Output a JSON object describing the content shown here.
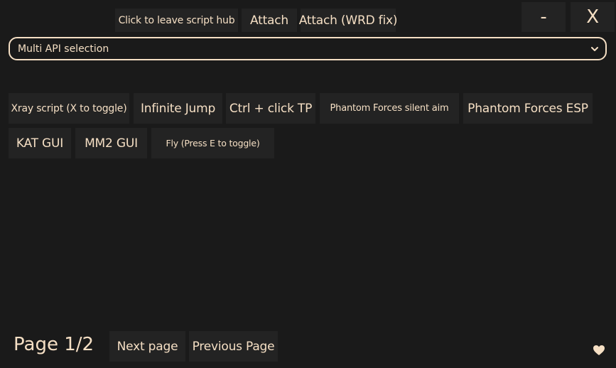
{
  "top_bar": {
    "leave_hub_label": "Click to leave script hub",
    "attach_label": "Attach",
    "attach_wrd_label": "Attach (WRD fix)",
    "minimize_label": "-",
    "close_label": "X"
  },
  "api_select": {
    "selected_value": "Multi API selection"
  },
  "scripts": {
    "row1": [
      "Xray script (X to toggle)",
      "Infinite Jump",
      "Ctrl + click TP",
      "Phantom Forces silent aim",
      "Phantom Forces ESP"
    ],
    "row2": [
      "KAT GUI",
      "MM2 GUI",
      "Fly (Press E to toggle)"
    ]
  },
  "pagination": {
    "page_label": "Page 1/2",
    "next_label": "Next page",
    "prev_label": "Previous Page"
  },
  "icons": {
    "heart": "heart-icon",
    "dropdown": "chevron-down-icon"
  },
  "colors": {
    "background": "#1a1a1a",
    "button": "#232323",
    "text": "#f5dfc4"
  }
}
